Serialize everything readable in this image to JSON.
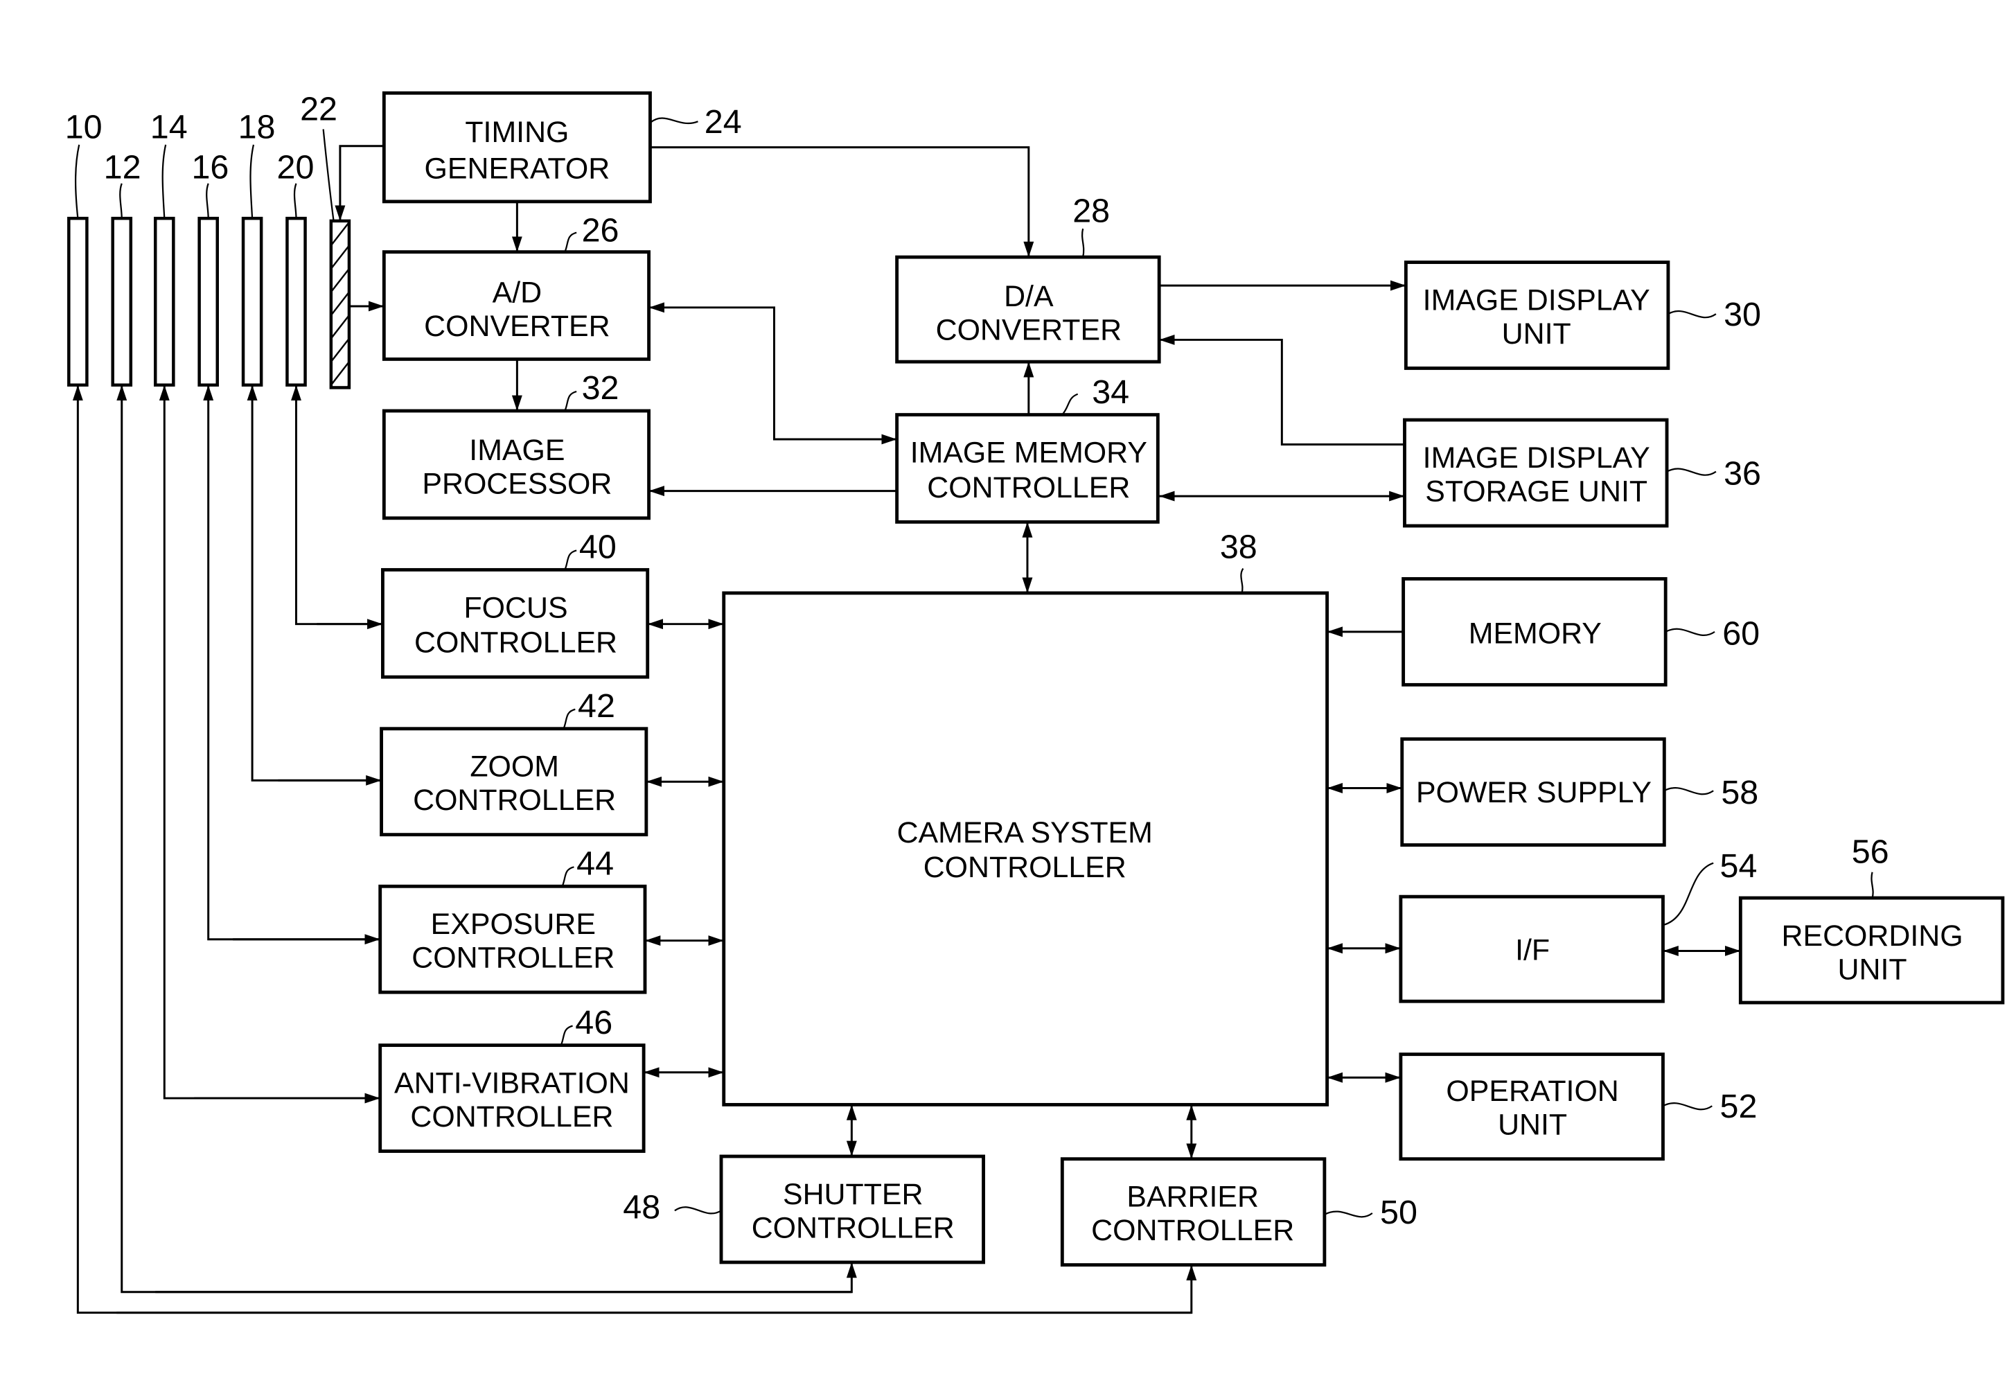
{
  "figure": {
    "description": "Camera system block diagram"
  },
  "lens_elements": [
    {
      "ref": "10"
    },
    {
      "ref": "12"
    },
    {
      "ref": "14"
    },
    {
      "ref": "16"
    },
    {
      "ref": "18"
    },
    {
      "ref": "20"
    },
    {
      "ref": "22"
    }
  ],
  "blocks": {
    "timing_generator": {
      "ref": "24",
      "lines": [
        "TIMING",
        "GENERATOR"
      ]
    },
    "ad_converter": {
      "ref": "26",
      "lines": [
        "A/D",
        "CONVERTER"
      ]
    },
    "da_converter": {
      "ref": "28",
      "lines": [
        "D/A",
        "CONVERTER"
      ]
    },
    "image_display_unit": {
      "ref": "30",
      "lines": [
        "IMAGE DISPLAY",
        "UNIT"
      ]
    },
    "image_processor": {
      "ref": "32",
      "lines": [
        "IMAGE",
        "PROCESSOR"
      ]
    },
    "image_memory_controller": {
      "ref": "34",
      "lines": [
        "IMAGE MEMORY",
        "CONTROLLER"
      ]
    },
    "image_display_storage_unit": {
      "ref": "36",
      "lines": [
        "IMAGE DISPLAY",
        "STORAGE UNIT"
      ]
    },
    "camera_system_controller": {
      "ref": "38",
      "lines": [
        "CAMERA SYSTEM",
        "CONTROLLER"
      ]
    },
    "focus_controller": {
      "ref": "40",
      "lines": [
        "FOCUS",
        "CONTROLLER"
      ]
    },
    "zoom_controller": {
      "ref": "42",
      "lines": [
        "ZOOM",
        "CONTROLLER"
      ]
    },
    "exposure_controller": {
      "ref": "44",
      "lines": [
        "EXPOSURE",
        "CONTROLLER"
      ]
    },
    "anti_vibration_controller": {
      "ref": "46",
      "lines": [
        "ANTI-VIBRATION",
        "CONTROLLER"
      ]
    },
    "shutter_controller": {
      "ref": "48",
      "lines": [
        "SHUTTER",
        "CONTROLLER"
      ]
    },
    "barrier_controller": {
      "ref": "50",
      "lines": [
        "BARRIER",
        "CONTROLLER"
      ]
    },
    "operation_unit": {
      "ref": "52",
      "lines": [
        "OPERATION",
        "UNIT"
      ]
    },
    "interface": {
      "ref": "54",
      "lines": [
        "I/F"
      ]
    },
    "recording_unit": {
      "ref": "56",
      "lines": [
        "RECORDING",
        "UNIT"
      ]
    },
    "power_supply": {
      "ref": "58",
      "lines": [
        "POWER SUPPLY"
      ]
    },
    "memory": {
      "ref": "60",
      "lines": [
        "MEMORY"
      ]
    }
  }
}
